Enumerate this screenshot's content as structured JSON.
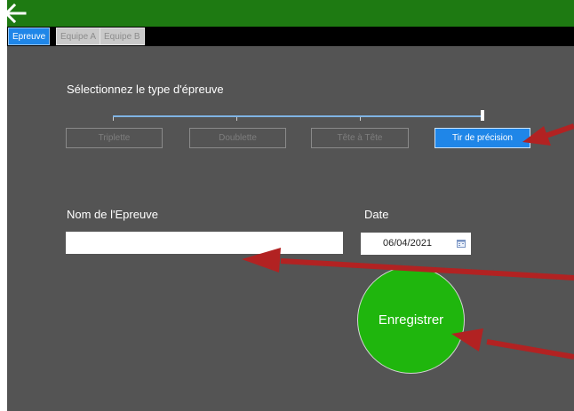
{
  "tabs": [
    {
      "label": "Epreuve",
      "active": true
    },
    {
      "label": "Equipe A",
      "active": false
    },
    {
      "label": "Equipe B",
      "active": false
    }
  ],
  "event_type": {
    "prompt": "Sélectionnez le type d'épreuve",
    "options": [
      "Triplette",
      "Doublette",
      "Tête à Tête",
      "Tir de précision"
    ],
    "selected_index": 3
  },
  "form": {
    "name_label": "Nom de l'Epreuve",
    "name_value": "",
    "date_label": "Date",
    "date_value": "06/04/2021"
  },
  "save_label": "Enregistrer",
  "colors": {
    "header_green": "#1e7a12",
    "panel_gray": "#545454",
    "accent_blue": "#1f86e8",
    "save_green": "#1fb60d",
    "annotation_red": "#b22222"
  },
  "icons": [
    "arrow-left-icon",
    "calendar-icon"
  ]
}
